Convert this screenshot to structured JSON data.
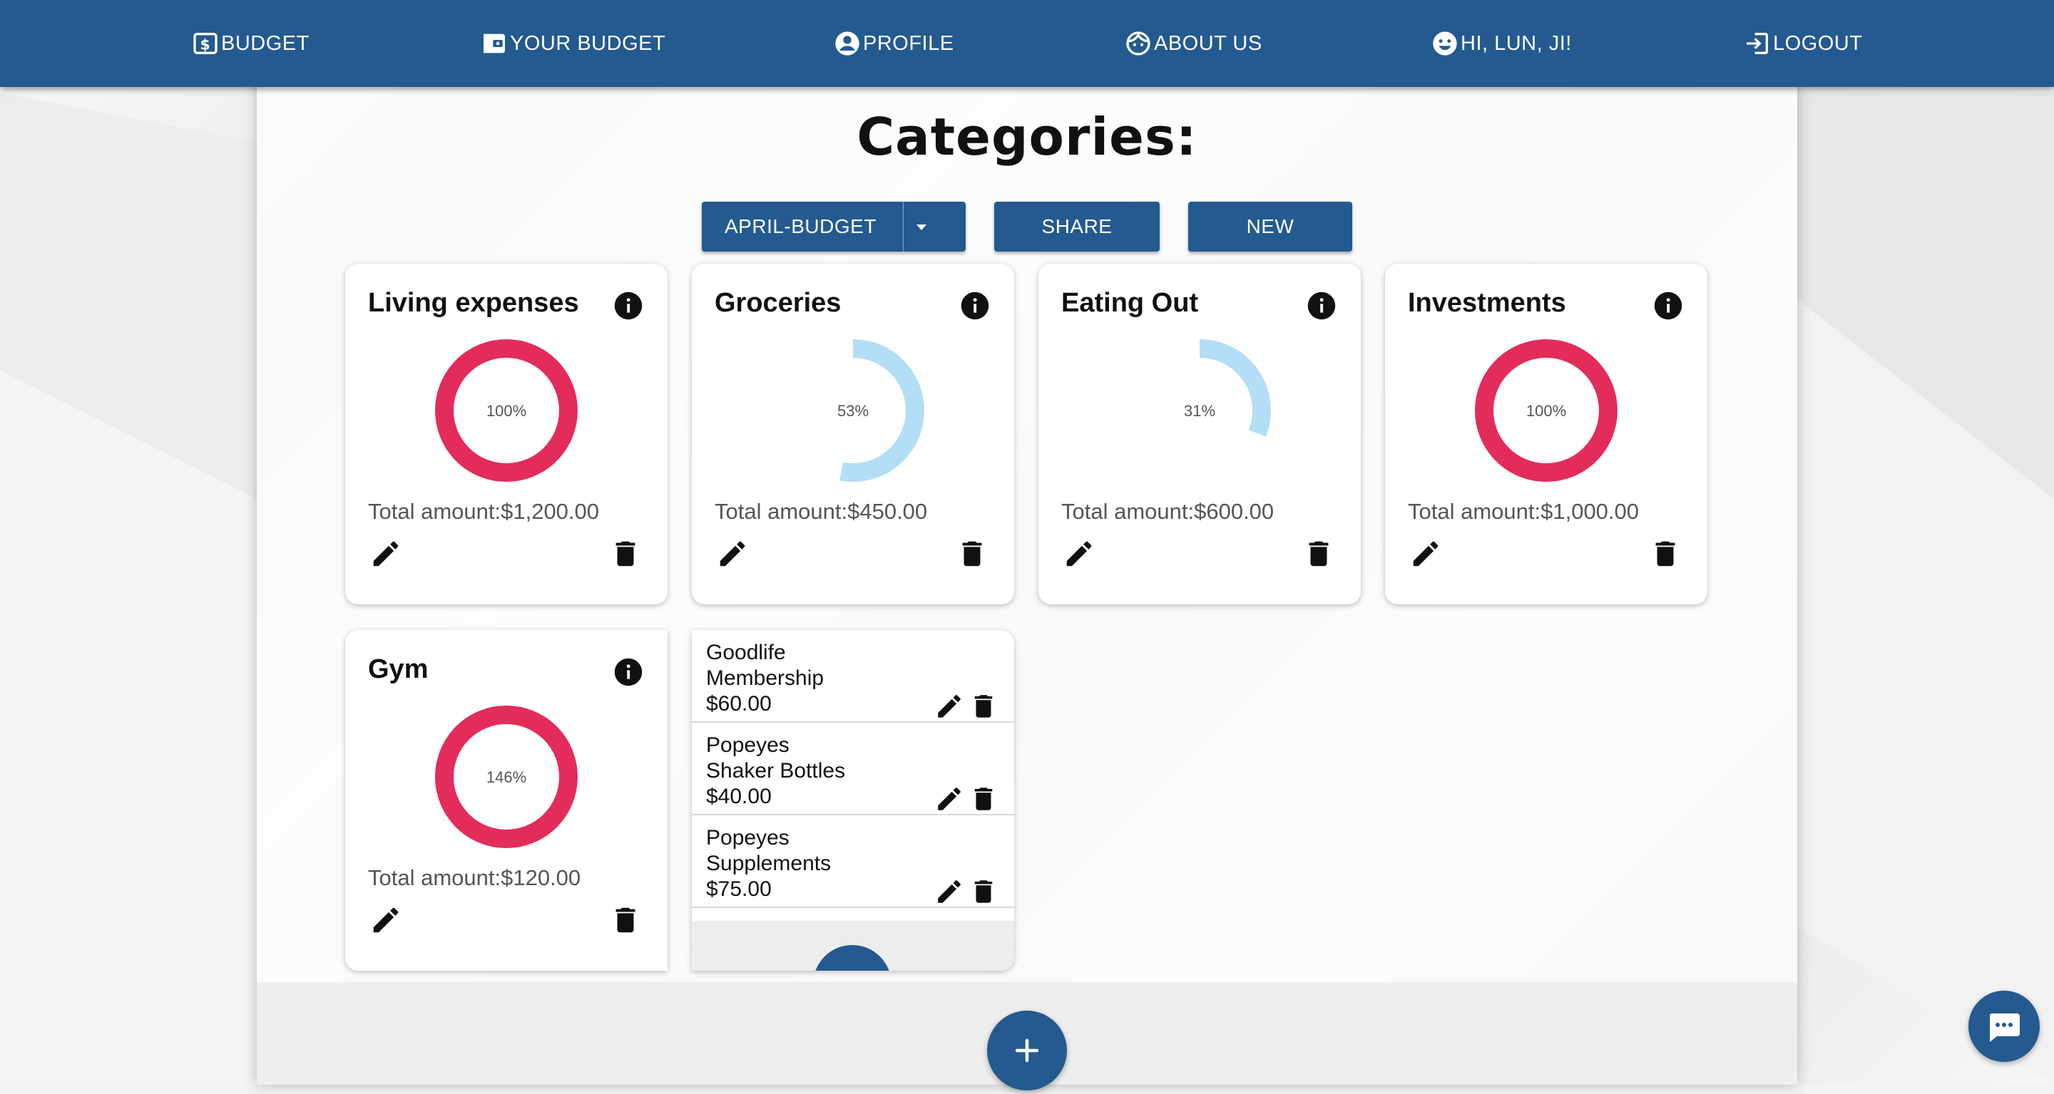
{
  "nav": {
    "budget": "BUDGET",
    "your_budget": "YOUR BUDGET",
    "profile": "PROFILE",
    "about": "ABOUT US",
    "greeting": "HI, LUN, JI!",
    "logout": "LOGOUT"
  },
  "page_title": "Categories:",
  "toolbar": {
    "budget_select": "APRIL-BUDGET",
    "share": "SHARE",
    "new": "NEW"
  },
  "categories": [
    {
      "name": "Living expenses",
      "percent_label": "100%",
      "percent": 100,
      "total": "Total amount:$1,200.00",
      "color": "#e32c5a"
    },
    {
      "name": "Groceries",
      "percent_label": "53%",
      "percent": 53,
      "total": "Total amount:$450.00",
      "color": "#b3def6"
    },
    {
      "name": "Eating Out",
      "percent_label": "31%",
      "percent": 31,
      "total": "Total amount:$600.00",
      "color": "#b3def6"
    },
    {
      "name": "Investments",
      "percent_label": "100%",
      "percent": 100,
      "total": "Total amount:$1,000.00",
      "color": "#e32c5a"
    },
    {
      "name": "Gym",
      "percent_label": "146%",
      "percent": 146,
      "total": "Total amount:$120.00",
      "color": "#e32c5a"
    }
  ],
  "gym_items": [
    {
      "line1": "Goodlife",
      "line2": "Membership",
      "amount": "$60.00"
    },
    {
      "line1": "Popeyes",
      "line2": "Shaker Bottles",
      "amount": "$40.00"
    },
    {
      "line1": "Popeyes",
      "line2": "Supplements",
      "amount": "$75.00"
    }
  ],
  "colors": {
    "primary": "#245a8f",
    "over_budget": "#e32c5a",
    "under_budget": "#b3def6"
  },
  "icons": [
    "dollar-icon",
    "wallet-icon",
    "account-circle-icon",
    "face-icon",
    "smiley-icon",
    "logout-icon",
    "info-icon",
    "edit-icon",
    "trash-icon",
    "plus-icon",
    "chat-icon",
    "caret-down-icon"
  ]
}
